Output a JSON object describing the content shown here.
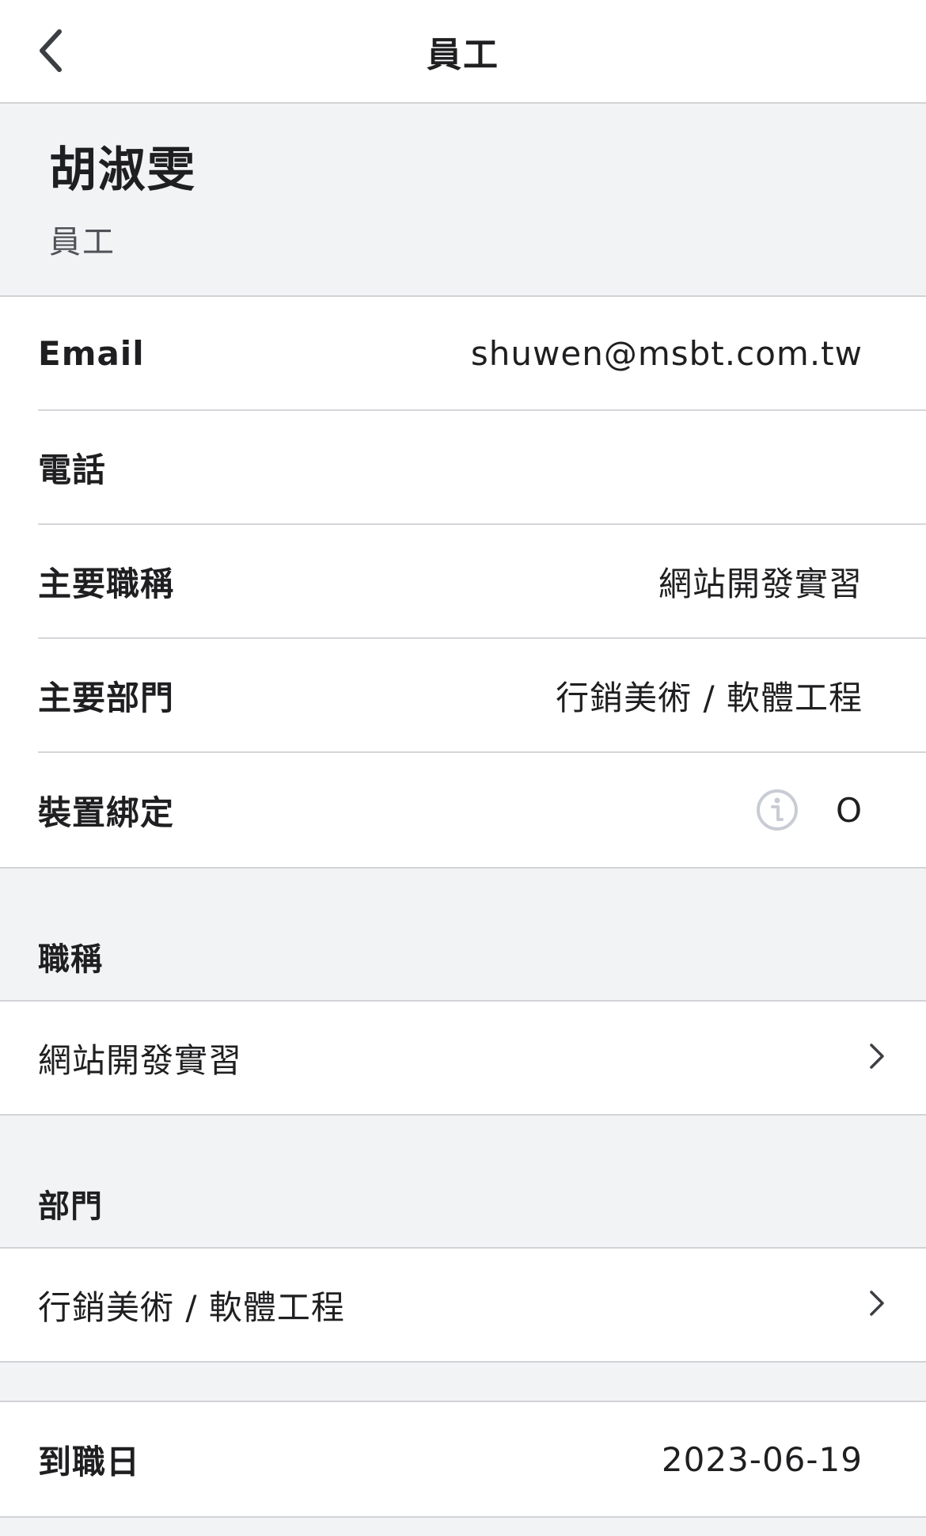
{
  "header": {
    "title": "員工",
    "back_icon": "chevron-left-icon"
  },
  "profile": {
    "name": "胡淑雯",
    "role": "員工"
  },
  "details": {
    "email_label": "Email",
    "email_value": "shuwen@msbt.com.tw",
    "phone_label": "電話",
    "phone_value": "",
    "title_label": "主要職稱",
    "title_value": "網站開發實習",
    "department_label": "主要部門",
    "department_value": "行銷美術 / 軟體工程",
    "device_label": "裝置綁定",
    "device_value": "O",
    "device_info_icon": "info-icon"
  },
  "titles_section": {
    "header": "職稱",
    "items": [
      "網站開發實習"
    ]
  },
  "departments_section": {
    "header": "部門",
    "items": [
      "行銷美術 / 軟體工程"
    ]
  },
  "hire": {
    "label": "到職日",
    "value": "2023-06-19"
  },
  "colors": {
    "background": "#f2f3f5",
    "card": "#ffffff",
    "divider": "#d5d6d9",
    "text": "#1f1f21",
    "secondary_text": "#4e5257",
    "icon_gray": "#c9ccd4"
  }
}
